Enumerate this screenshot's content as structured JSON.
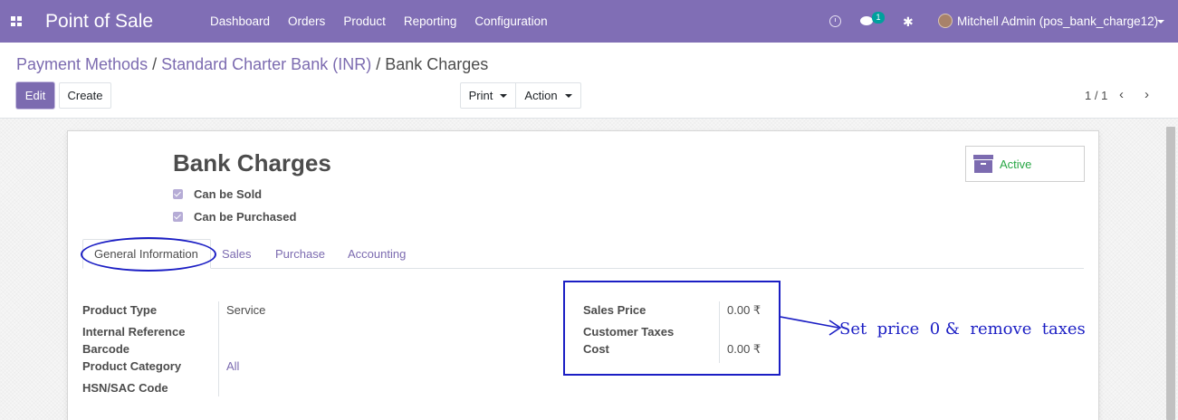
{
  "navbar": {
    "app_name": "Point of Sale",
    "menu": [
      "Dashboard",
      "Orders",
      "Product",
      "Reporting",
      "Configuration"
    ],
    "chat_badge": "1",
    "user_name": "Mitchell Admin (pos_bank_charge12)",
    "icons": [
      "apps-grid-icon",
      "clock-icon",
      "chat-icon",
      "bug-icon",
      "avatar",
      "caret-down-icon"
    ]
  },
  "breadcrumb": {
    "items": [
      "Payment Methods",
      "Standard Charter Bank (INR)"
    ],
    "current": "Bank Charges",
    "separator": "/"
  },
  "toolbar": {
    "edit_label": "Edit",
    "create_label": "Create",
    "print_label": "Print",
    "action_label": "Action"
  },
  "pager": {
    "value": "1 / 1",
    "prev_icon": "‹",
    "next_icon": "›"
  },
  "form": {
    "title": "Bank Charges",
    "status_button": "Active",
    "can_be_sold": "Can be Sold",
    "can_be_purchased": "Can be Purchased",
    "tabs": [
      "General Information",
      "Sales",
      "Purchase",
      "Accounting"
    ],
    "left_fields": {
      "product_type_label": "Product Type",
      "product_type_value": "Service",
      "internal_reference_label": "Internal Reference",
      "barcode_label": "Barcode",
      "product_category_label": "Product Category",
      "product_category_value": "All",
      "hsn_label": "HSN/SAC Code"
    },
    "right_fields": {
      "sales_price_label": "Sales Price",
      "sales_price_value": "0.00 ₹",
      "customer_taxes_label": "Customer Taxes",
      "cost_label": "Cost",
      "cost_value": "0.00 ₹"
    }
  },
  "annotation": {
    "text": "Set  price  0 &  remove  taxes",
    "color": "#1b1ec4"
  },
  "colors": {
    "brand": "#806eb5",
    "link": "#7c6bb0",
    "active_green": "#28a745"
  }
}
